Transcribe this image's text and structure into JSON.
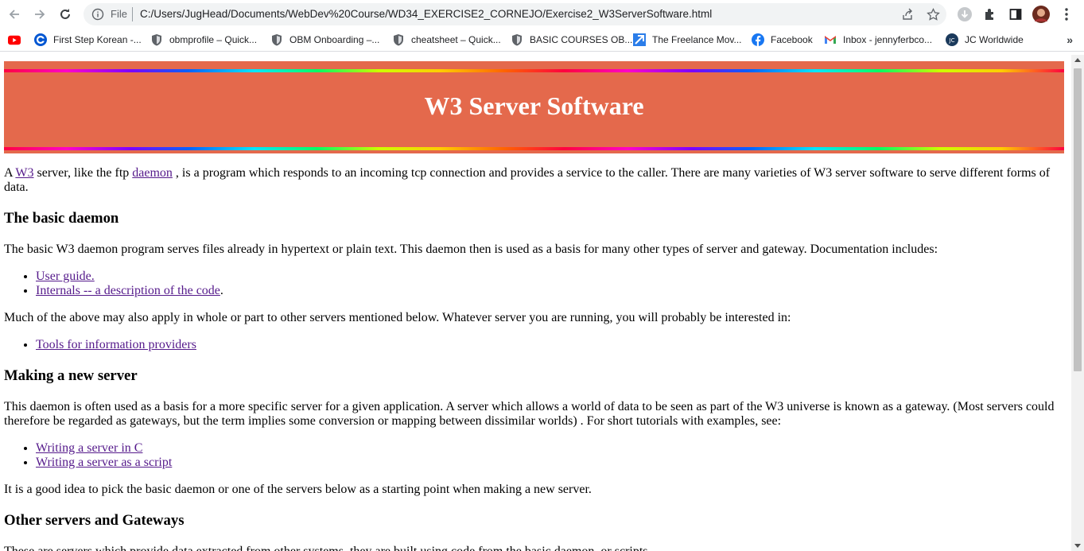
{
  "browser": {
    "scheme_label": "File",
    "url": "C:/Users/JugHead/Documents/WebDev%20Course/WD34_EXERCISE2_CORNEJO/Exercise2_W3ServerSoftware.html",
    "bookmarks": [
      {
        "label": "First Step Korean -...",
        "icon": "coursera-icon"
      },
      {
        "label": "obmprofile – Quick...",
        "icon": "shield-icon"
      },
      {
        "label": "OBM Onboarding –...",
        "icon": "shield-icon"
      },
      {
        "label": "cheatsheet – Quick...",
        "icon": "shield-icon"
      },
      {
        "label": "BASIC COURSES OB...",
        "icon": "shield-icon"
      },
      {
        "label": "The Freelance Mov...",
        "icon": "freelance-icon"
      },
      {
        "label": "Facebook",
        "icon": "facebook-icon"
      },
      {
        "label": "Inbox - jennyferbco...",
        "icon": "gmail-icon"
      },
      {
        "label": "JC Worldwide",
        "icon": "jc-icon"
      }
    ],
    "more_label": "»"
  },
  "page": {
    "title": "W3 Server Software",
    "intro": {
      "t1": "A ",
      "link_w3": "W3",
      "t2": " server, like the ftp ",
      "link_daemon": "daemon",
      "t3": " , is a program which responds to an incoming tcp connection and provides a service to the caller. There are many varieties of W3 server software to serve different forms of data."
    },
    "basic": {
      "heading": "The basic daemon",
      "para": "The basic W3 daemon program serves files already in hypertext or plain text. This daemon then is used as a basis for many other types of server and gateway. Documentation includes:",
      "links": [
        "User guide.",
        "Internals -- a description of the code"
      ],
      "internals_suffix": ".",
      "para2": "Much of the above may also apply in whole or part to other servers mentioned below. Whatever server you are running, you will probably be interested in:",
      "tools_link": "Tools for information providers"
    },
    "making": {
      "heading": "Making a new server",
      "para": "This daemon is often used as a basis for a more specific server for a given application. A server which allows a world of data to be seen as part of the W3 universe is known as a gateway. (Most servers could therefore be regarded as gateways, but the term implies some conversion or mapping between dissimilar worlds) . For short tutorials with examples, see:",
      "links": [
        "Writing a server in C",
        "Writing a server as a script"
      ],
      "para2": "It is a good idea to pick the basic daemon or one of the servers below as a starting point when making a new server."
    },
    "other": {
      "heading": "Other servers and Gateways",
      "para": "These are servers which provide data extracted from other systems, they are built using code from the basic daemon, or scripts."
    }
  },
  "colors": {
    "banner": "#e4694c",
    "link_visited": "#551a8b"
  }
}
